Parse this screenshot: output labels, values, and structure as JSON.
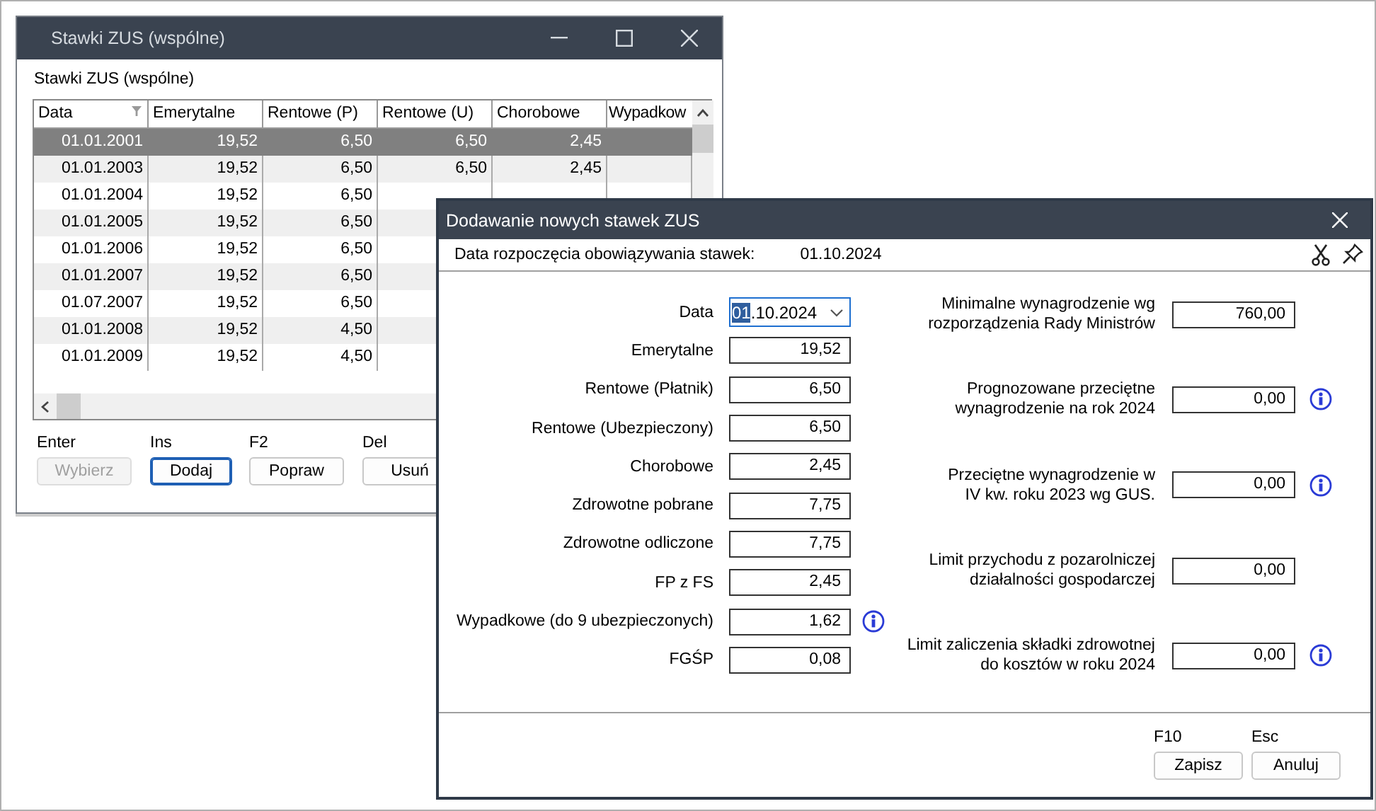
{
  "rates_window": {
    "title": "Stawki ZUS (wspólne)",
    "heading": "Stawki ZUS (wspólne)",
    "columns": [
      "Data",
      "Emerytalne",
      "Rentowe (P)",
      "Rentowe (U)",
      "Chorobowe",
      "Wypadkow"
    ],
    "rows": [
      {
        "cells": [
          "01.01.2001",
          "19,52",
          "6,50",
          "6,50",
          "2,45"
        ],
        "selected": true
      },
      {
        "cells": [
          "01.01.2003",
          "19,52",
          "6,50",
          "6,50",
          "2,45"
        ],
        "selected": false
      },
      {
        "cells": [
          "01.01.2004",
          "19,52",
          "6,50"
        ],
        "selected": false
      },
      {
        "cells": [
          "01.01.2005",
          "19,52",
          "6,50"
        ],
        "selected": false
      },
      {
        "cells": [
          "01.01.2006",
          "19,52",
          "6,50"
        ],
        "selected": false
      },
      {
        "cells": [
          "01.01.2007",
          "19,52",
          "6,50"
        ],
        "selected": false
      },
      {
        "cells": [
          "01.07.2007",
          "19,52",
          "6,50"
        ],
        "selected": false
      },
      {
        "cells": [
          "01.01.2008",
          "19,52",
          "4,50"
        ],
        "selected": false
      },
      {
        "cells": [
          "01.01.2009",
          "19,52",
          "4,50"
        ],
        "selected": false
      }
    ],
    "shortcuts": [
      {
        "key": "Enter",
        "label": "Wybierz",
        "disabled": true,
        "focused": false
      },
      {
        "key": "Ins",
        "label": "Dodaj",
        "disabled": false,
        "focused": true
      },
      {
        "key": "F2",
        "label": "Popraw",
        "disabled": false,
        "focused": false
      },
      {
        "key": "Del",
        "label": "Usuń",
        "disabled": false,
        "focused": false
      }
    ]
  },
  "add_dialog": {
    "title": "Dodawanie nowych stawek ZUS",
    "start_label": "Data rozpoczęcia obowiązywania stawek:",
    "start_date": "01.10.2024",
    "date_field": {
      "label": "Data",
      "highlighted": "01",
      "rest": ".10.2024"
    },
    "left_fields": [
      {
        "label": "Emerytalne",
        "value": "19,52",
        "info": false
      },
      {
        "label": "Rentowe (Płatnik)",
        "value": "6,50",
        "info": false
      },
      {
        "label": "Rentowe (Ubezpieczony)",
        "value": "6,50",
        "info": false
      },
      {
        "label": "Chorobowe",
        "value": "2,45",
        "info": false
      },
      {
        "label": "Zdrowotne pobrane",
        "value": "7,75",
        "info": false
      },
      {
        "label": "Zdrowotne odliczone",
        "value": "7,75",
        "info": false
      },
      {
        "label": "FP z FS",
        "value": "2,45",
        "info": false
      },
      {
        "label": "Wypadkowe (do 9 ubezpieczonych)",
        "value": "1,62",
        "info": true
      },
      {
        "label": "FGŚP",
        "value": "0,08",
        "info": false
      }
    ],
    "right_fields": [
      {
        "label": [
          "Minimalne wynagrodzenie wg",
          "rozporządzenia Rady Ministrów"
        ],
        "value": "760,00",
        "info": false
      },
      {
        "label": [
          "Prognozowane przeciętne",
          "wynagrodzenie na rok 2024"
        ],
        "value": "0,00",
        "info": true
      },
      {
        "label": [
          "Przeciętne wynagrodzenie w",
          "IV kw. roku 2023 wg GUS."
        ],
        "value": "0,00",
        "info": true
      },
      {
        "label": [
          "Limit przychodu z pozarolniczej",
          "działalności gospodarczej"
        ],
        "value": "0,00",
        "info": false
      },
      {
        "label": [
          "Limit zaliczenia składki zdrowotnej",
          "do kosztów w roku 2024"
        ],
        "value": "0,00",
        "info": true
      }
    ],
    "buttons": [
      {
        "key": "F10",
        "label": "Zapisz"
      },
      {
        "key": "Esc",
        "label": "Anuluj"
      }
    ]
  }
}
